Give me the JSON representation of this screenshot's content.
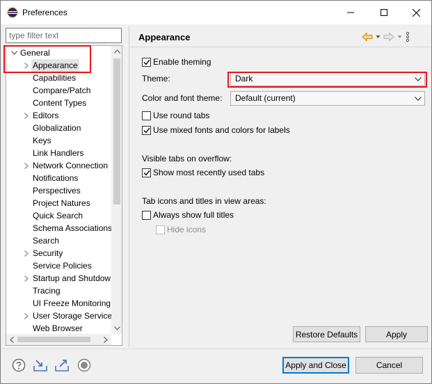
{
  "window": {
    "title": "Preferences",
    "icons": {
      "app": "eclipse-icon",
      "minimize": "minimize-icon",
      "maximize": "maximize-icon",
      "close": "close-icon"
    }
  },
  "filter": {
    "placeholder": "type filter text",
    "value": ""
  },
  "tree": {
    "items": [
      {
        "label": "General",
        "expanded": true,
        "level": 0
      },
      {
        "label": "Appearance",
        "expandable": true,
        "selected": true,
        "level": 1
      },
      {
        "label": "Capabilities",
        "level": 1
      },
      {
        "label": "Compare/Patch",
        "level": 1
      },
      {
        "label": "Content Types",
        "level": 1
      },
      {
        "label": "Editors",
        "expandable": true,
        "level": 1
      },
      {
        "label": "Globalization",
        "level": 1
      },
      {
        "label": "Keys",
        "level": 1
      },
      {
        "label": "Link Handlers",
        "level": 1
      },
      {
        "label": "Network Connection",
        "expandable": true,
        "level": 1
      },
      {
        "label": "Notifications",
        "level": 1
      },
      {
        "label": "Perspectives",
        "level": 1
      },
      {
        "label": "Project Natures",
        "level": 1
      },
      {
        "label": "Quick Search",
        "level": 1
      },
      {
        "label": "Schema Associations",
        "level": 1
      },
      {
        "label": "Search",
        "level": 1
      },
      {
        "label": "Security",
        "expandable": true,
        "level": 1
      },
      {
        "label": "Service Policies",
        "level": 1
      },
      {
        "label": "Startup and Shutdow",
        "expandable": true,
        "level": 1
      },
      {
        "label": "Tracing",
        "level": 1
      },
      {
        "label": "UI Freeze Monitoring",
        "level": 1
      },
      {
        "label": "User Storage Service",
        "expandable": true,
        "level": 1
      },
      {
        "label": "Web Browser",
        "level": 1
      }
    ]
  },
  "page": {
    "title": "Appearance",
    "nav_icons": [
      "back-arrow-icon",
      "back-menu-icon",
      "forward-arrow-icon",
      "forward-menu-icon",
      "view-menu-icon"
    ],
    "enable_theming": {
      "label": "Enable theming",
      "checked": true
    },
    "theme": {
      "label": "Theme:",
      "value": "Dark"
    },
    "color_font_theme": {
      "label": "Color and font theme:",
      "value": "Default (current)"
    },
    "round_tabs": {
      "label": "Use round tabs",
      "checked": false
    },
    "mixed_fonts": {
      "label": "Use mixed fonts and colors for labels",
      "checked": true
    },
    "visible_tabs_heading": "Visible tabs on overflow:",
    "show_recent_tabs": {
      "label": "Show most recently used tabs",
      "checked": true
    },
    "tab_icons_heading": "Tab icons and titles in view areas:",
    "always_full_titles": {
      "label": "Always show full titles",
      "checked": false
    },
    "hide_icons": {
      "label": "Hide icons",
      "checked": false,
      "disabled": true
    },
    "restore_defaults": "Restore Defaults",
    "apply": "Apply"
  },
  "footer": {
    "icons": [
      "help-icon",
      "import-icon",
      "export-icon",
      "record-icon"
    ],
    "apply_and_close": "Apply and Close",
    "cancel": "Cancel"
  },
  "colors": {
    "highlight": "#e8141b",
    "selection": "#e5e5e5",
    "default_button_border": "#0078d7"
  }
}
